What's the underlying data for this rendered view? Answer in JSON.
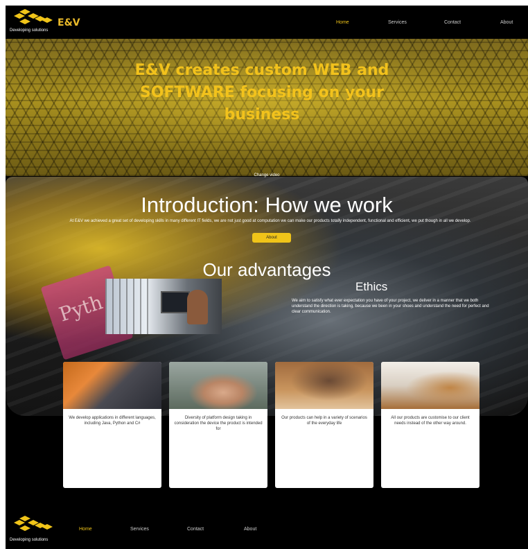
{
  "header": {
    "brand": "E&V",
    "tagline": "Developing solutions",
    "nav": [
      "Home",
      "Services",
      "Contact",
      "About"
    ],
    "active": "Home"
  },
  "hero": {
    "title": "E&V creates custom WEB and SOFTWARE focusing on your business",
    "change_video": "Change video"
  },
  "intro": {
    "title": "Introduction: How we work",
    "text": "At E&V we achieved a great set of developing skills in many different IT fields, we are not just good at computation we can make our products totally independent, functional and efficient, we put though in all we develop.",
    "button": "About",
    "book_text": "Pyth"
  },
  "advantages": {
    "title": "Our advantages",
    "ethics_title": "Ethics",
    "ethics_text": "We aim to satisfy what ever expectation you have of your project, we deliver in a manner that we both understand the direction is taking, because we been in your shoes and understand the need for perfect and clear communication."
  },
  "cards": [
    {
      "text": "We develop applications in different languages, including Java, Python and C#"
    },
    {
      "text": "Diversity of platform design taking in consideration the device the product is intended for"
    },
    {
      "text": "Our products can help in a variety of scenarios of the everyday life"
    },
    {
      "text": "All our products are customise to our client needs instead of the other way around."
    }
  ],
  "footer": {
    "tagline": "Developing solutions",
    "nav": [
      "Home",
      "Services",
      "Contact",
      "About"
    ]
  },
  "colors": {
    "accent": "#f0c419",
    "background": "#000000"
  }
}
